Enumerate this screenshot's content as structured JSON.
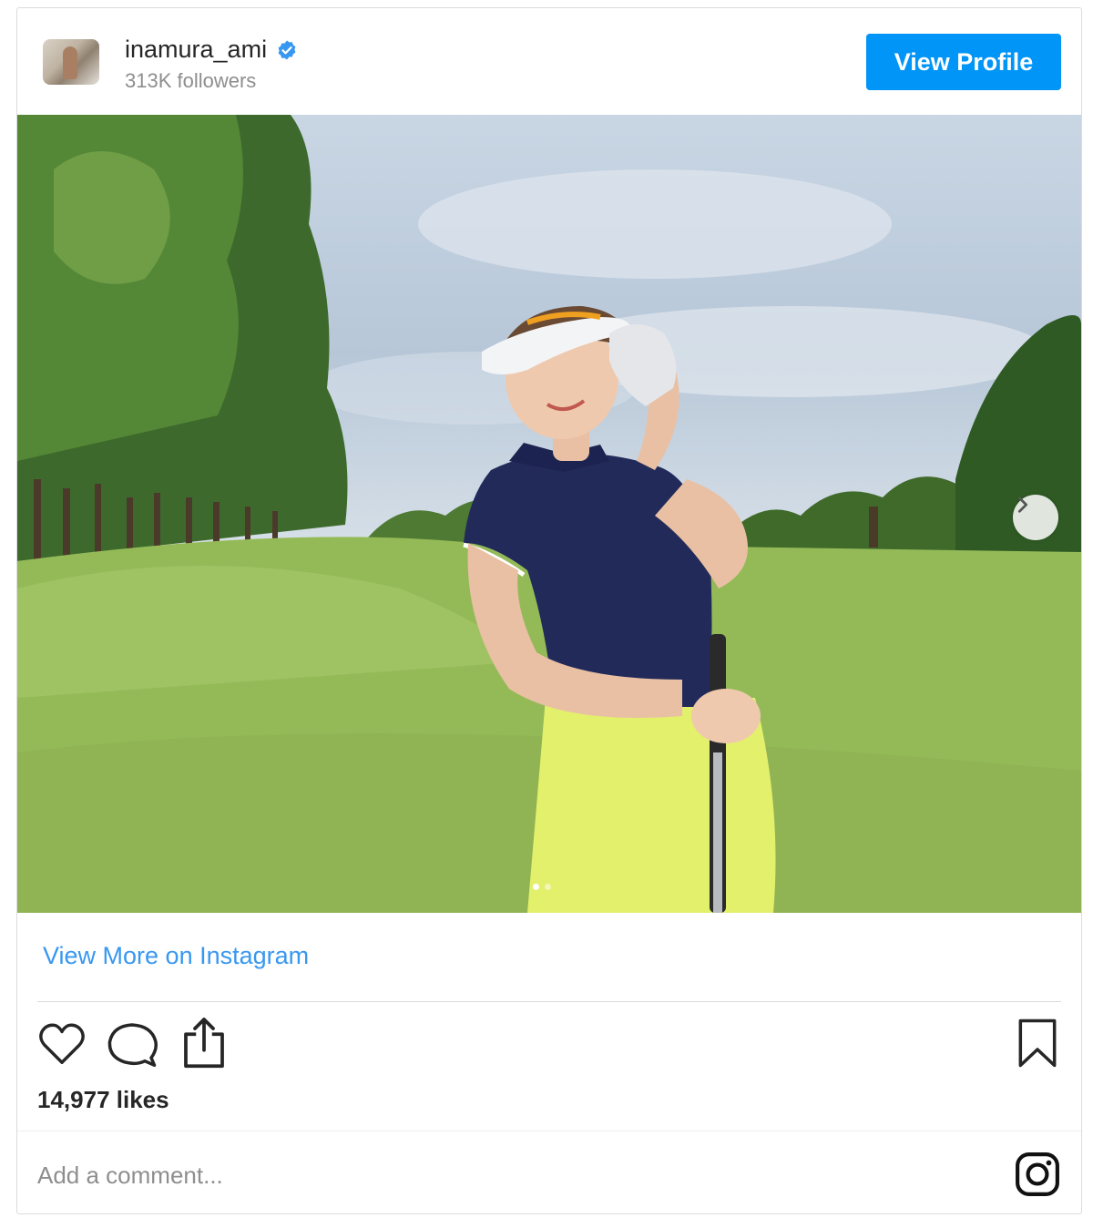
{
  "header": {
    "username": "inamura_ami",
    "followers": "313K followers",
    "view_profile_label": "View Profile"
  },
  "post": {
    "carousel_next": "chevron-right-icon",
    "carousel_pages": 2,
    "carousel_active_page": 1
  },
  "view_more_label": "View More on Instagram",
  "actions": {
    "like": "heart-icon",
    "comment": "comment-icon",
    "share": "share-icon",
    "save": "bookmark-icon"
  },
  "likes_text": "14,977 likes",
  "comment": {
    "placeholder": "Add a comment..."
  },
  "colors": {
    "accent": "#0095f6",
    "link": "#3897f0",
    "verified": "#3897f0",
    "muted": "#8e8e8e",
    "border": "#dbdbdb"
  }
}
